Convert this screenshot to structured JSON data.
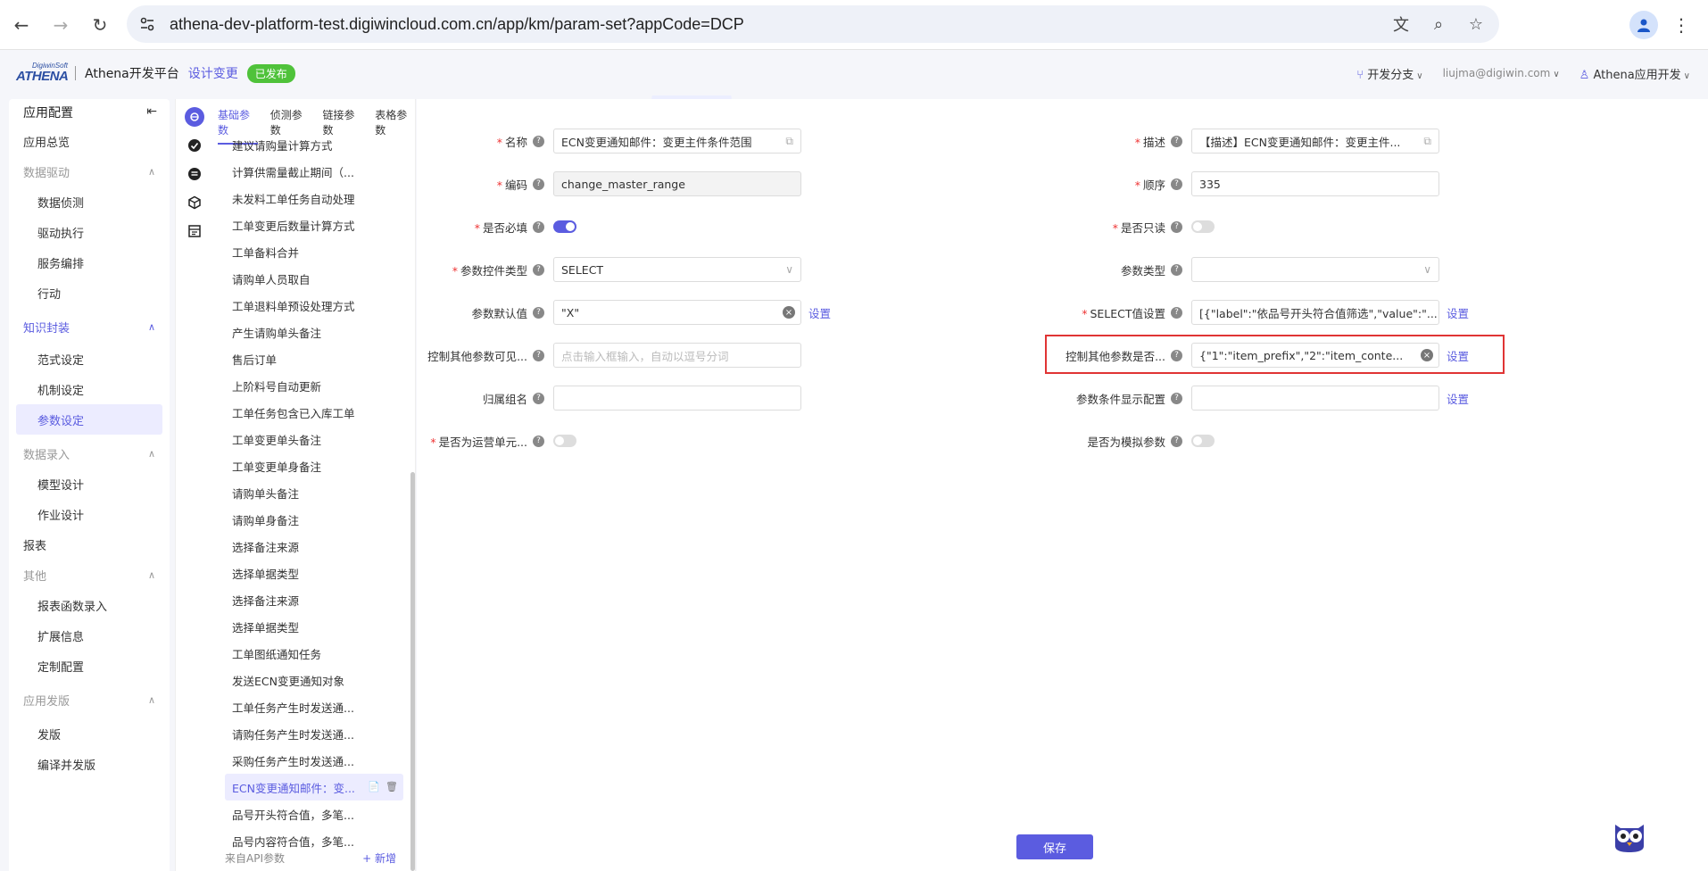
{
  "browser": {
    "url": "athena-dev-platform-test.digiwincloud.com.cn/app/km/param-set?appCode=DCP"
  },
  "header": {
    "brand_top": "DigiwinSoft",
    "brand_main": "ATHENA",
    "platform_name": "Athena开发平台",
    "design_change": "设计变更",
    "status_badge": "已发布",
    "branch": "开发分支",
    "email": "liujma@digiwin.com",
    "user": "Athena应用开发"
  },
  "sidebar": {
    "title": "应用配置",
    "overview": "应用总览",
    "groups": [
      {
        "label": "数据驱动",
        "items": [
          "数据侦测",
          "驱动执行",
          "服务编排",
          "行动"
        ]
      },
      {
        "label": "知识封装",
        "items": [
          "范式设定",
          "机制设定",
          "参数设定"
        ]
      },
      {
        "label": "数据录入",
        "items": [
          "模型设计",
          "作业设计"
        ]
      }
    ],
    "report": "报表",
    "groups2": [
      {
        "label": "其他",
        "items": [
          "报表函数录入",
          "扩展信息",
          "定制配置"
        ]
      },
      {
        "label": "应用发版",
        "items": [
          "发版",
          "编译并发版"
        ]
      }
    ]
  },
  "tabs": [
    "基础参数",
    "侦测参数",
    "链接参数",
    "表格参数"
  ],
  "param_list": [
    "建议请购量计算方式",
    "计算供需量截止期间（...",
    "未发料工单任务自动处理",
    "工单变更后数量计算方式",
    "工单备料合并",
    "请购单人员取自",
    "工单退料单预设处理方式",
    "产生请购单头备注",
    "售后订单",
    "上阶料号自动更新",
    "工单任务包含已入库工单",
    "工单变更单头备注",
    "工单变更单身备注",
    "请购单头备注",
    "请购单身备注",
    "选择备注来源",
    "选择单据类型",
    "选择备注来源",
    "选择单据类型",
    "工单图纸通知任务",
    "发送ECN变更通知对象",
    "工单任务产生时发送通...",
    "请购任务产生时发送通...",
    "采购任务产生时发送通...",
    "ECN变更通知邮件：变...",
    "品号开头符合值，多笔...",
    "品号内容符合值，多笔..."
  ],
  "list_footer": {
    "label": "来自API参数",
    "add": "+ 新增"
  },
  "form": {
    "name_label": "名称",
    "name_value": "ECN变更通知邮件：变更主件条件范围",
    "desc_label": "描述",
    "desc_value": "【描述】ECN变更通知邮件：变更主件...",
    "code_label": "编码",
    "code_value": "change_master_range",
    "order_label": "顺序",
    "order_value": "335",
    "required_label": "是否必填",
    "required_on": true,
    "readonly_label": "是否只读",
    "readonly_on": false,
    "control_type_label": "参数控件类型",
    "control_type_value": "SELECT",
    "param_type_label": "参数类型",
    "param_type_value": "",
    "default_label": "参数默认值",
    "default_value": "\"X\"",
    "select_label": "SELECT值设置",
    "select_value": "[{\"label\":\"依品号开头符合值筛选\",\"value\":\"...",
    "visible_label": "控制其他参数可见...",
    "visible_placeholder": "点击输入框输入，自动以逗号分词",
    "control_other_label": "控制其他参数是否...",
    "control_other_value": "{\"1\":\"item_prefix\",\"2\":\"item_conte...",
    "group_label": "归属组名",
    "group_value": "",
    "cond_label": "参数条件显示配置",
    "cond_value": "",
    "ops_label": "是否为运营单元...",
    "ops_on": false,
    "mock_label": "是否为模拟参数",
    "mock_on": false,
    "set_link": "设置"
  },
  "save_label": "保存",
  "colors": {
    "accent": "#5b5ce0",
    "badge": "#4fc23a",
    "highlight": "#e03434"
  }
}
